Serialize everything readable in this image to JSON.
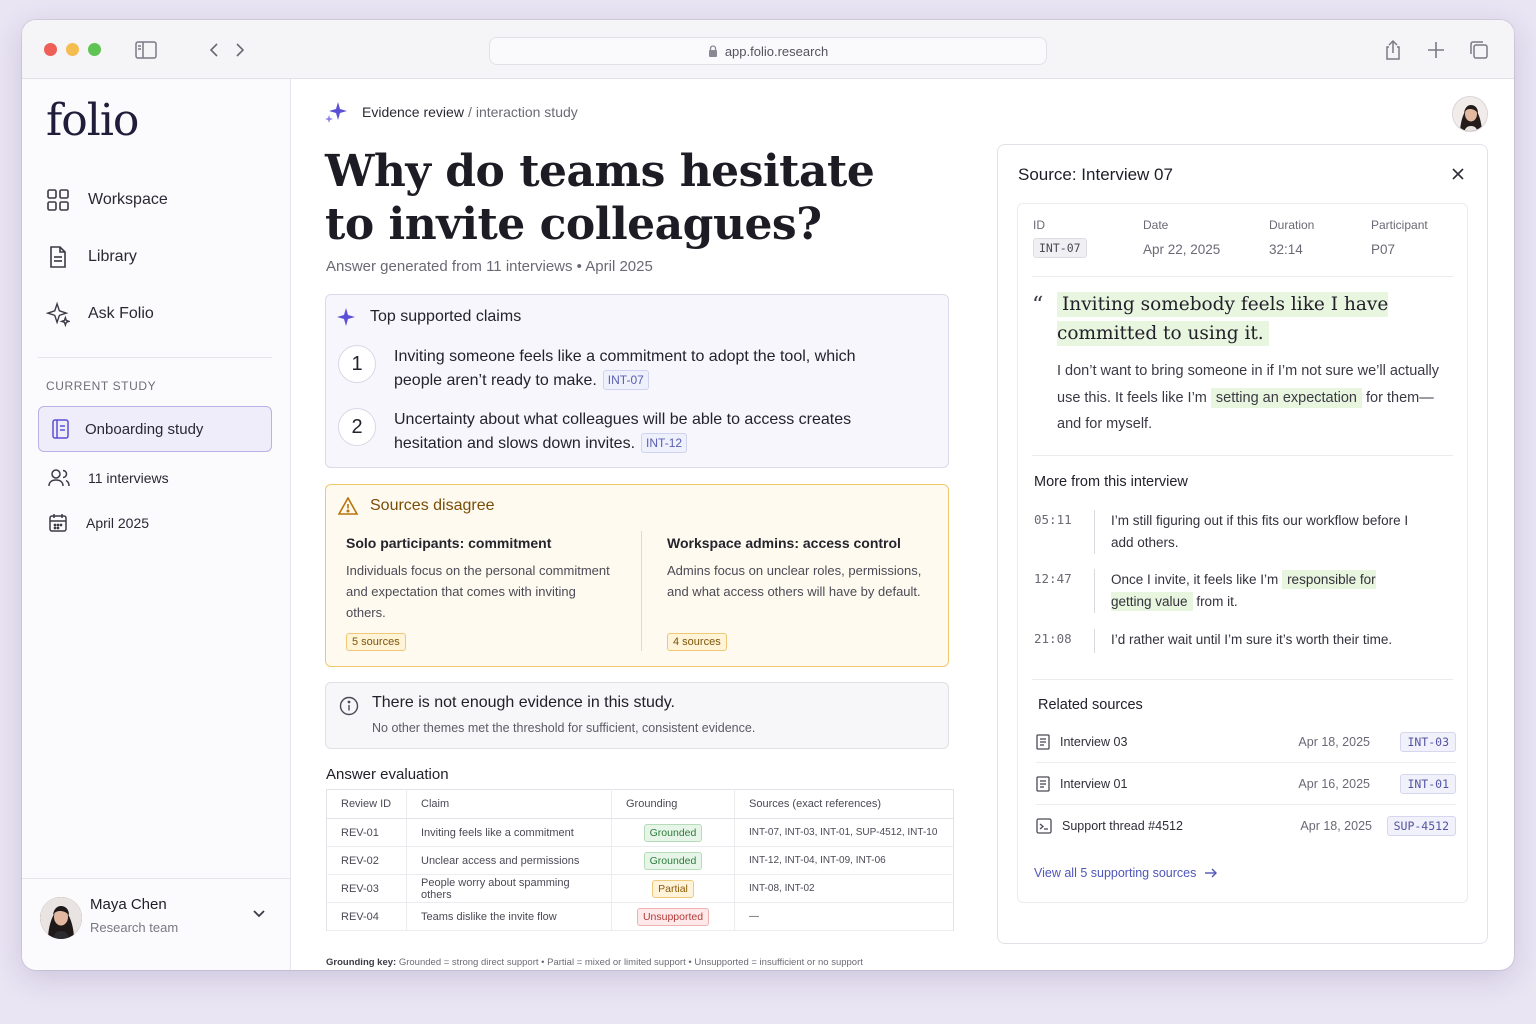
{
  "browser": {
    "url": "app.folio.research"
  },
  "sidebar": {
    "logo": "folio",
    "nav": [
      {
        "label": "Workspace",
        "icon": "grid-icon"
      },
      {
        "label": "Library",
        "icon": "document-icon"
      },
      {
        "label": "Ask Folio",
        "icon": "sparkle-icon"
      }
    ],
    "section_label": "CURRENT STUDY",
    "study": "Onboarding study",
    "interviews": "11 interviews",
    "date": "April 2025",
    "user": {
      "name": "Maya Chen",
      "team": "Research team"
    }
  },
  "main": {
    "breadcrumb": {
      "section": "Evidence review",
      "separator": "/",
      "page": "interaction study"
    },
    "title": "Why do teams hesitate to invite colleagues?",
    "subtitle": "Answer generated from 11 interviews  •  April 2025",
    "claims": {
      "heading": "Top supported claims",
      "items": [
        {
          "num": "1",
          "text": "Inviting someone feels like a commitment to adopt the tool, which people aren’t ready to make.",
          "ref": "INT-07"
        },
        {
          "num": "2",
          "text": "Uncertainty about what colleagues will be able to access creates hesitation and slows down invites.",
          "ref": "INT-12"
        }
      ]
    },
    "disagree": {
      "heading": "Sources disagree",
      "left": {
        "title": "Solo participants: commitment",
        "text": "Individuals focus on the personal commitment and expectation that comes with inviting others.",
        "sources": "5 sources"
      },
      "right": {
        "title": "Workspace admins: access control",
        "text": "Admins focus on unclear roles, permissions, and what access others will have by default.",
        "sources": "4 sources"
      }
    },
    "no_evidence": {
      "heading": "There is not enough evidence in this study.",
      "text": "No other themes met the threshold for sufficient, consistent evidence."
    },
    "evaluation": {
      "heading": "Answer evaluation",
      "columns": [
        "Review ID",
        "Claim",
        "Grounding",
        "Sources (exact references)"
      ],
      "rows": [
        {
          "id": "REV-01",
          "claim": "Inviting feels like a commitment",
          "grounding": "Grounded",
          "sources": "INT-07, INT-03, INT-01, SUP-4512, INT-10"
        },
        {
          "id": "REV-02",
          "claim": "Unclear access and permissions",
          "grounding": "Grounded",
          "sources": "INT-12, INT-04, INT-09, INT-06"
        },
        {
          "id": "REV-03",
          "claim": "People worry about spamming others",
          "grounding": "Partial",
          "sources": "INT-08, INT-02"
        },
        {
          "id": "REV-04",
          "claim": "Teams dislike the invite flow",
          "grounding": "Unsupported",
          "sources": "—"
        }
      ],
      "key_label": "Grounding key:",
      "key_text": "Grounded  =  strong direct support   •   Partial  =  mixed or limited support   •   Unsupported  =  insufficient or no support"
    }
  },
  "panel": {
    "title": "Source: Interview 07",
    "meta": {
      "labels": [
        "ID",
        "Date",
        "Duration",
        "Participant"
      ],
      "id": "INT-07",
      "date": "Apr 22, 2025",
      "duration": "32:14",
      "participant": "P07"
    },
    "quote": "Inviting somebody feels like I have committed to using it.",
    "body_a": "I don’t want to bring someone in if I’m not sure we’ll actually use this. It feels like I’m ",
    "body_hl": "setting an expectation",
    "body_b": " for them—and for myself.",
    "more_heading": "More from this interview",
    "turns": [
      {
        "ts": "05:11",
        "a": "I’m still figuring out if this fits our workflow before I add others.",
        "hl": "",
        "b": ""
      },
      {
        "ts": "12:47",
        "a": "Once I invite, it feels like I’m ",
        "hl": "responsible for getting value",
        "b": " from it."
      },
      {
        "ts": "21:08",
        "a": "I’d rather wait until I’m sure it’s worth their time.",
        "hl": "",
        "b": ""
      }
    ],
    "related_heading": "Related sources",
    "related": [
      {
        "name": "Interview 03",
        "date": "Apr 18, 2025",
        "tag": "INT-03"
      },
      {
        "name": "Interview 01",
        "date": "Apr 16, 2025",
        "tag": "INT-01"
      },
      {
        "name": "Support thread #4512",
        "date": "Apr 18, 2025",
        "tag": "SUP-4512"
      }
    ],
    "view_all": "View all 5 supporting sources"
  },
  "colors": {
    "accent": "#5b4fd6",
    "warning": "#f0c86e",
    "grounded": "#2d7d3b",
    "partial": "#8b5a07",
    "unsupported": "#b23a3a"
  }
}
